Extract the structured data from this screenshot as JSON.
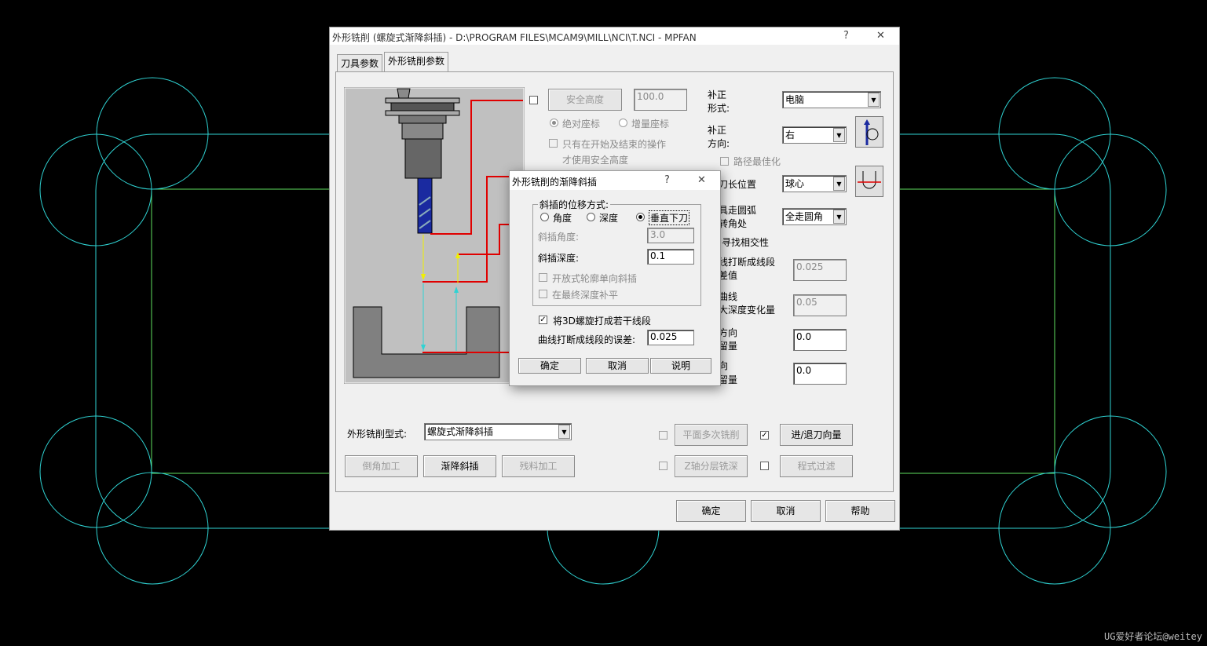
{
  "main_window": {
    "title": "外形铣削 (螺旋式渐降斜插) - D:\\PROGRAM FILES\\MCAM9\\MILL\\NCI\\T.NCI - MPFAN",
    "help_btn": "?",
    "close_btn": "✕",
    "tabs": [
      "刀具参数",
      "外形铣削参数"
    ],
    "active_tab": 1,
    "safety": {
      "button": "安全高度",
      "value": "100.0",
      "abs_coord": "绝对座标",
      "inc_coord": "增量座标",
      "only_start_end_line1": "只有在开始及结束的操作",
      "only_start_end_line2": "才使用安全高度"
    },
    "comp_type": {
      "label_line1": "补正",
      "label_line2": "形式:",
      "value": "电脑"
    },
    "comp_dir": {
      "label_line1": "补正",
      "label_line2": "方向:",
      "value": "右"
    },
    "path_opt": "路径最佳化",
    "tip_pos": {
      "label": "刀长位置",
      "value": "球心"
    },
    "arc": {
      "label_line1": "具走圆弧",
      "label_line2": "转角处",
      "value": "全走圆角"
    },
    "intersect": "寻找相交性",
    "line_break": {
      "label_line1": "线打断成线段",
      "label_line2": "差值",
      "value": "0.025"
    },
    "curve_depth": {
      "label_line1": "曲线",
      "label_line2": "大深度变化量",
      "value": "0.05"
    },
    "xy_stock": {
      "label_line1": "方向",
      "label_line2": "留量",
      "value": "0.0"
    },
    "z_stock": {
      "label_line1": "向",
      "label_line2": "留量",
      "value": "0.0"
    },
    "contour_type": {
      "label": "外形铣削型式:",
      "value": "螺旋式渐降斜插"
    },
    "btn_chamfer": "倒角加工",
    "btn_ramp": "渐降斜插",
    "btn_remachine": "残料加工",
    "btn_multipass": "平面多次铣削",
    "btn_leadinout": "进/退刀向量",
    "btn_depthcuts": "Z轴分层铣深",
    "btn_filter": "程式过滤",
    "ok": "确定",
    "cancel": "取消",
    "help": "帮助"
  },
  "ramp_dialog": {
    "title": "外形铣削的渐降斜插",
    "help_btn": "?",
    "close_btn": "✕",
    "group_label": "斜插的位移方式:",
    "opt_angle": "角度",
    "opt_depth": "深度",
    "opt_plunge": "垂直下刀",
    "ramp_angle_label": "斜插角度:",
    "ramp_angle_value": "3.0",
    "ramp_depth_label": "斜插深度:",
    "ramp_depth_value": "0.1",
    "open_contour": "开放式轮廓单向斜插",
    "flat_final": "在最终深度补平",
    "break_helix": "将3D螺旋打成若干线段",
    "tolerance_label": "曲线打断成线段的误差:",
    "tolerance_value": "0.025",
    "ok": "确定",
    "cancel": "取消",
    "explain": "说明"
  },
  "watermark": "UG爱好者论坛@weitey",
  "colors": {
    "cyan": "#2fd3d3",
    "green": "#5fe05f",
    "red": "#e00000",
    "yellow": "#f0f000",
    "tool_blue": "#1a2aa0"
  }
}
